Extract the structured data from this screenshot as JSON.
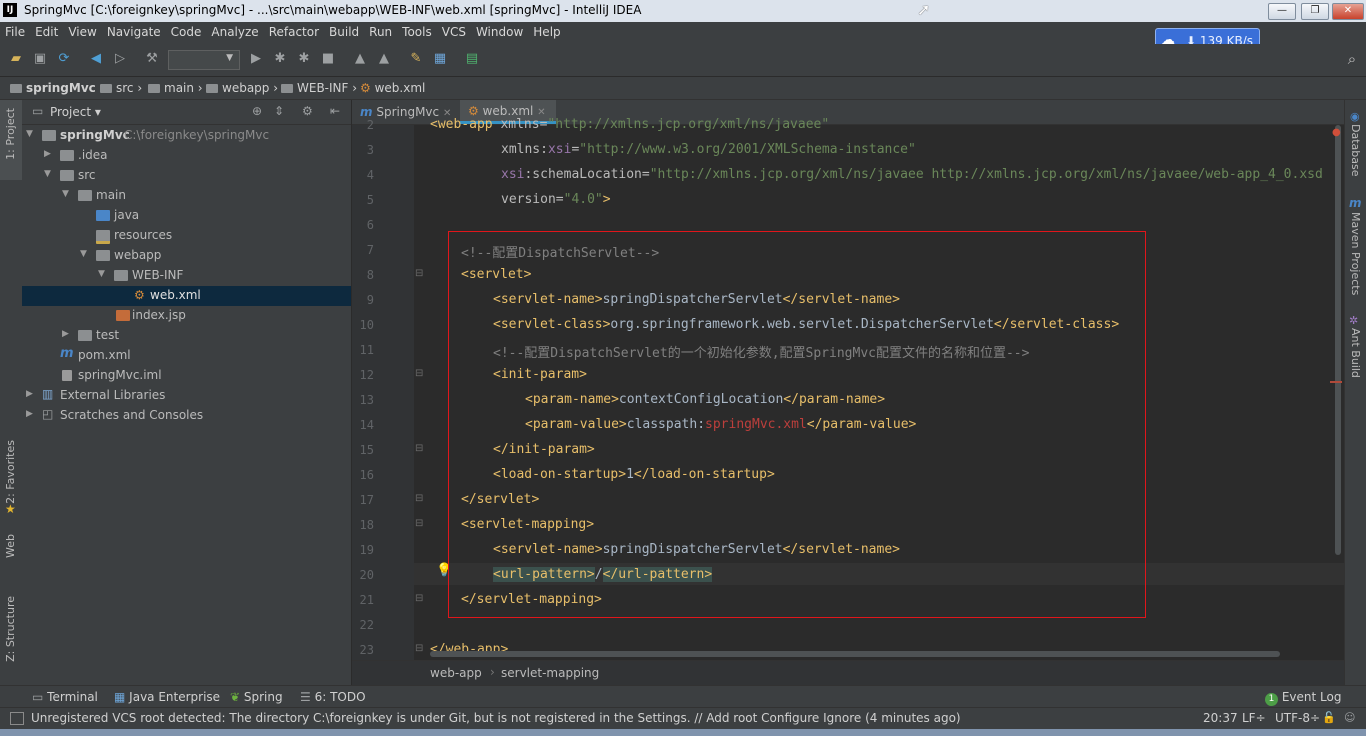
{
  "window": {
    "title": "SpringMvc [C:\\foreignkey\\springMvc] - ...\\src\\main\\webapp\\WEB-INF\\web.xml [springMvc] - IntelliJ IDEA"
  },
  "menu": [
    "File",
    "Edit",
    "View",
    "Navigate",
    "Code",
    "Analyze",
    "Refactor",
    "Build",
    "Run",
    "Tools",
    "VCS",
    "Window",
    "Help"
  ],
  "network": {
    "speed": "139 KB/s"
  },
  "breadcrumb": [
    "springMvc",
    "src",
    "main",
    "webapp",
    "WEB-INF",
    "web.xml"
  ],
  "left_tabs": {
    "project": "1: Project",
    "favorites": "2: Favorites",
    "web": "Web",
    "structure": "Z: Structure"
  },
  "right_tabs": {
    "database": "Database",
    "maven": "Maven Projects",
    "ant": "Ant Build"
  },
  "project": {
    "header": "Project",
    "tree": [
      {
        "label": "springMvc",
        "hint": "C:\\foreignkey\\springMvc"
      },
      {
        "label": ".idea"
      },
      {
        "label": "src"
      },
      {
        "label": "main"
      },
      {
        "label": "java"
      },
      {
        "label": "resources"
      },
      {
        "label": "webapp"
      },
      {
        "label": "WEB-INF"
      },
      {
        "label": "web.xml"
      },
      {
        "label": "index.jsp"
      },
      {
        "label": "test"
      },
      {
        "label": "pom.xml"
      },
      {
        "label": "springMvc.iml"
      },
      {
        "label": "External Libraries"
      },
      {
        "label": "Scratches and Consoles"
      }
    ]
  },
  "editor": {
    "tabs": [
      {
        "label": "SpringMvc"
      },
      {
        "label": "web.xml"
      }
    ],
    "line_numbers": [
      "2",
      "3",
      "4",
      "5",
      "6",
      "7",
      "8",
      "9",
      "10",
      "11",
      "12",
      "13",
      "14",
      "15",
      "16",
      "17",
      "18",
      "19",
      "20",
      "21",
      "22",
      "23"
    ],
    "lines": {
      "l2a": "<web-app ",
      "l2b": "xmlns=",
      "l2c": "\"http://xmlns.jcp.org/xml/ns/javaee\"",
      "l3a": "xmlns:",
      "l3b": "xsi",
      "l3c": "=",
      "l3d": "\"http://www.w3.org/2001/XMLSchema-instance\"",
      "l4a": "xsi",
      "l4b": ":schemaLocation=",
      "l4c": "\"http://xmlns.jcp.org/xml/ns/javaee http://xmlns.jcp.org/xml/ns/javaee/web-app_4_0.xsd",
      "l5a": "version=",
      "l5b": "\"4.0\"",
      "l5c": ">",
      "l7": "<!--配置DispatchServlet-->",
      "l8": "<servlet>",
      "l9a": "<servlet-name>",
      "l9b": "springDispatcherServlet",
      "l9c": "</servlet-name>",
      "l10a": "<servlet-class>",
      "l10b": "org.springframework.web.servlet.DispatcherServlet",
      "l10c": "</servlet-class>",
      "l11": "<!--配置DispatchServlet的一个初始化参数,配置SpringMvc配置文件的名称和位置-->",
      "l12": "<init-param>",
      "l13a": "<param-name>",
      "l13b": "contextConfigLocation",
      "l13c": "</param-name>",
      "l14a": "<param-value>",
      "l14b": "classpath:",
      "l14c": "springMvc.xml",
      "l14d": "</param-value>",
      "l15": "</init-param>",
      "l16a": "<load-on-startup>",
      "l16b": "1",
      "l16c": "</load-on-startup>",
      "l17": "</servlet>",
      "l18": "<servlet-mapping>",
      "l19a": "<servlet-name>",
      "l19b": "springDispatcherServlet",
      "l19c": "</servlet-name>",
      "l20a": "<url-pattern>",
      "l20b": "/",
      "l20c": "</url-pattern>",
      "l21": "</servlet-mapping>",
      "l23": "</web-app>"
    },
    "path": [
      "web-app",
      "servlet-mapping"
    ]
  },
  "bottom_tabs": {
    "terminal": "Terminal",
    "java_enterprise": "Java Enterprise",
    "spring": "Spring",
    "todo": "6: TODO",
    "event_log": "Event Log",
    "event_count": "1"
  },
  "status": {
    "message": "Unregistered VCS root detected: The directory C:\\foreignkey is under Git, but is not registered in the Settings. // Add root  Configure  Ignore (4 minutes ago)",
    "position": "20:37",
    "line_sep": "LF÷",
    "encoding": "UTF-8÷"
  },
  "colors": {
    "accent": "#3592c4",
    "tag": "#e8bf6a",
    "string": "#6a8759",
    "comment": "#808080",
    "highlight_box": "#e0161b"
  }
}
